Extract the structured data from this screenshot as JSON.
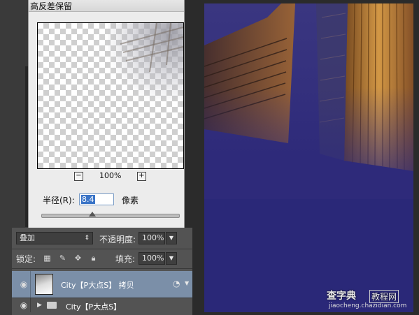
{
  "filter_dialog": {
    "title": "高反差保留",
    "zoom_out_label": "−",
    "zoom_in_label": "+",
    "zoom_level": "100%",
    "radius_label": "半径(R):",
    "radius_value": "8.4",
    "radius_unit": "像素",
    "radius_slider_fraction": 0.37
  },
  "layers_panel": {
    "blend_mode": "叠加",
    "opacity_label": "不透明度:",
    "opacity_value": "100%",
    "lock_label": "锁定:",
    "fill_label": "填充:",
    "fill_value": "100%",
    "layers": [
      {
        "name": "City【P大点S】 拷贝",
        "selected": true
      },
      {
        "name": "City【P大点S】",
        "selected": false,
        "is_group": true
      }
    ]
  },
  "watermark": {
    "main": "查字典",
    "secondary": "教程网",
    "url": "jiaocheng.chazidian.com"
  },
  "colors": {
    "selected_layer": "#7b8fa8",
    "panel_bg": "#535353",
    "photo_sky": "#2e2a7a",
    "building_glow": "#d08a2a"
  }
}
